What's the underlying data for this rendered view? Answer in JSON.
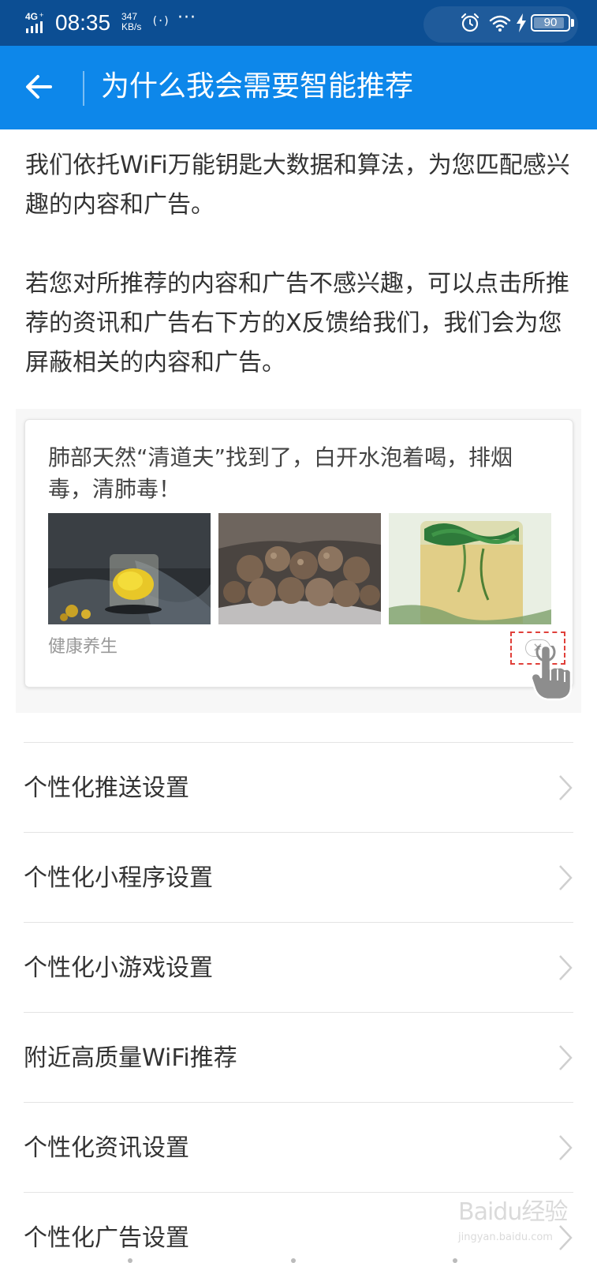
{
  "status_bar": {
    "network": "4G",
    "time": "08:35",
    "speed_value": "347",
    "speed_unit": "KB/s",
    "hotspot": "(·)",
    "more": "···",
    "battery": "90",
    "battery_level": 0.9
  },
  "app_bar": {
    "title": "为什么我会需要智能推荐"
  },
  "intro": {
    "paragraph_1": "我们依托WiFi万能钥匙大数据和算法，为您匹配感兴趣的内容和广告。",
    "paragraph_2": "若您对所推荐的内容和广告不感兴趣，可以点击所推荐的资讯和广告右下方的X反馈给我们，我们会为您屏蔽相关的内容和广告。"
  },
  "example_ad": {
    "title": "肺部天然“清道夫”找到了，白开水泡着喝，排烟毒，清肺毒！",
    "category": "健康养生",
    "close_symbol": "×"
  },
  "settings": [
    {
      "label": "个性化推送设置"
    },
    {
      "label": "个性化小程序设置"
    },
    {
      "label": "个性化小游戏设置"
    },
    {
      "label": "附近高质量WiFi推荐"
    },
    {
      "label": "个性化资讯设置"
    },
    {
      "label": "个性化广告设置"
    }
  ],
  "watermark": {
    "main": "Baidu经验",
    "sub": "jingyan.baidu.com"
  },
  "colors": {
    "status_bar": "#0c4e93",
    "app_bar": "#0d87ea",
    "highlight": "#e0403a"
  }
}
